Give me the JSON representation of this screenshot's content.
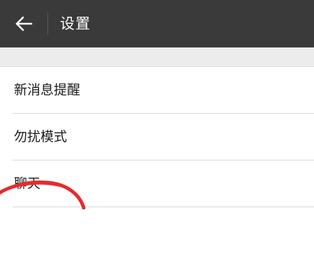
{
  "header": {
    "back_icon": "arrow-left-icon",
    "title": "设置"
  },
  "settings": {
    "items": [
      {
        "label": "新消息提醒"
      },
      {
        "label": "勿扰模式"
      },
      {
        "label": "聊天"
      },
      {
        "label": ""
      }
    ]
  },
  "colors": {
    "app_bar": "#3a3a3a",
    "section_gap": "#ececec",
    "annotation": "#e52b2b"
  }
}
